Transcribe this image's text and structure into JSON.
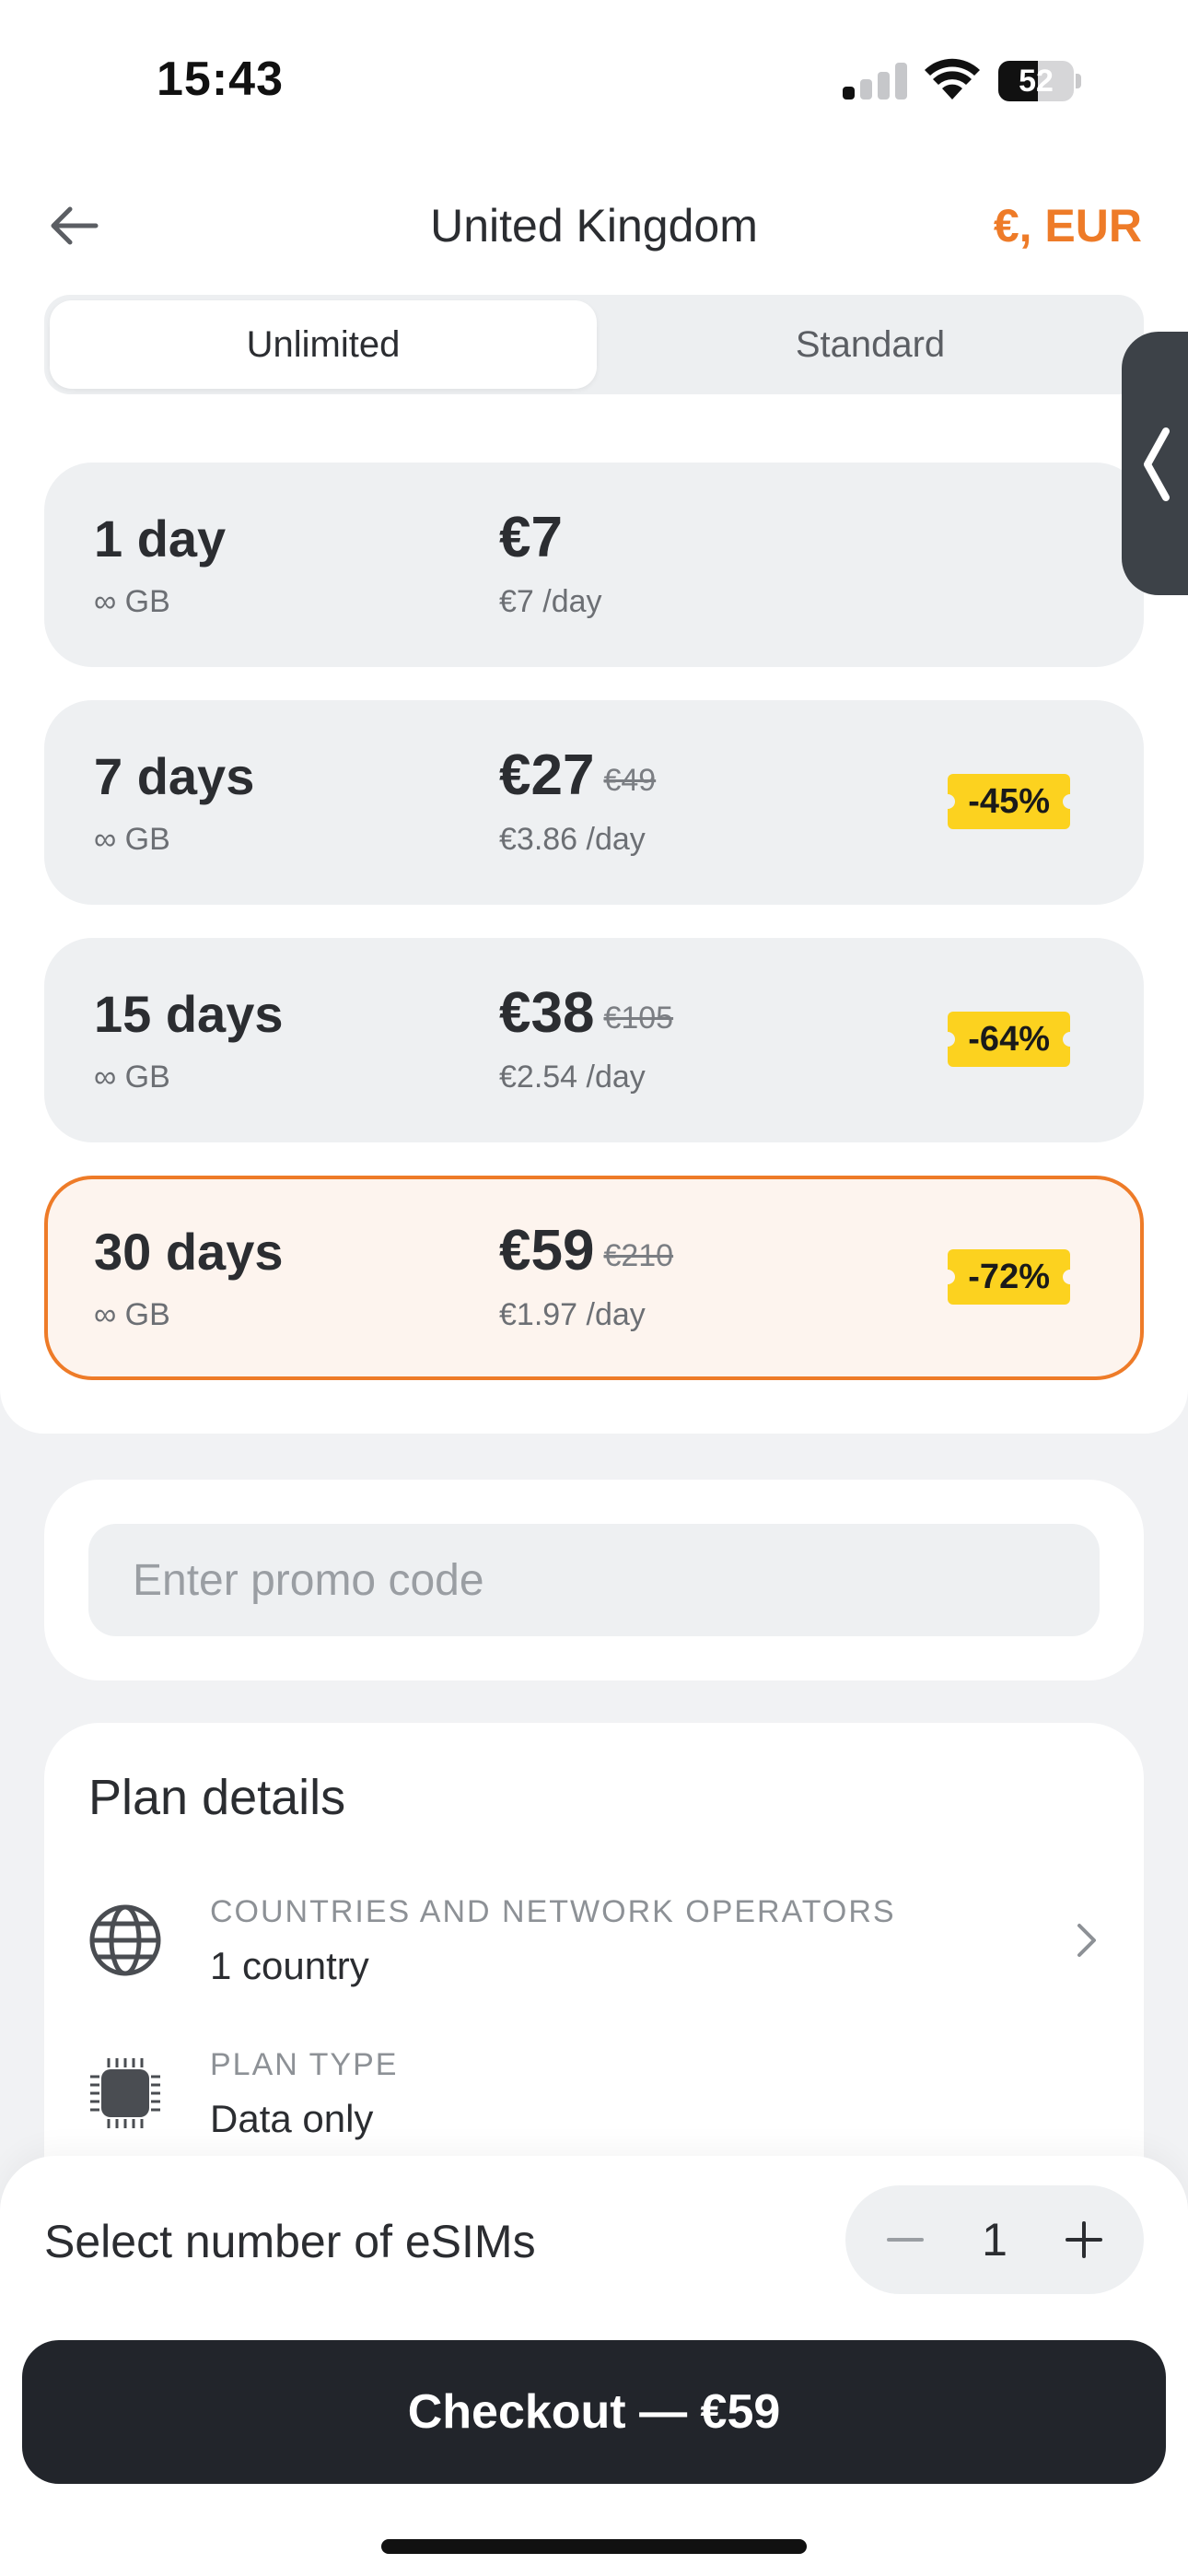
{
  "status_bar": {
    "time": "15:43",
    "battery": "52",
    "battery_level": 52
  },
  "header": {
    "title": "United Kingdom",
    "currency": "€, EUR",
    "back_icon": "arrow-left-icon"
  },
  "segment": {
    "tabs": [
      {
        "label": "Unlimited",
        "active": true
      },
      {
        "label": "Standard",
        "active": false
      }
    ]
  },
  "plans": [
    {
      "days": "1 day",
      "data": "∞ GB",
      "price": "€7",
      "old_price": "",
      "per_day": "€7 /day",
      "discount": "",
      "selected": false
    },
    {
      "days": "7 days",
      "data": "∞ GB",
      "price": "€27",
      "old_price": "€49",
      "per_day": "€3.86 /day",
      "discount": "-45%",
      "selected": false
    },
    {
      "days": "15 days",
      "data": "∞ GB",
      "price": "€38",
      "old_price": "€105",
      "per_day": "€2.54 /day",
      "discount": "-64%",
      "selected": false
    },
    {
      "days": "30 days",
      "data": "∞ GB",
      "price": "€59",
      "old_price": "€210",
      "per_day": "€1.97 /day",
      "discount": "-72%",
      "selected": true
    }
  ],
  "promo": {
    "placeholder": "Enter promo code",
    "value": ""
  },
  "details": {
    "title": "Plan details",
    "rows": [
      {
        "icon": "globe-icon",
        "label": "COUNTRIES AND NETWORK OPERATORS",
        "value": "1  country",
        "has_chevron": true
      },
      {
        "icon": "chip-icon",
        "label": "PLAN TYPE",
        "value": "Data only",
        "has_chevron": false
      }
    ]
  },
  "bottom": {
    "esim_label": "Select number of eSIMs",
    "quantity": "1",
    "checkout_label": "Checkout — €59"
  },
  "colors": {
    "accent": "#ee7b28",
    "badge": "#fcd21f",
    "button": "#22252b"
  }
}
